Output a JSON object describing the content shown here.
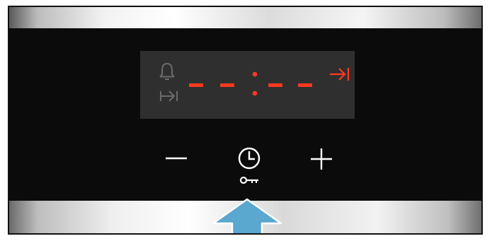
{
  "colors": {
    "panel": "#0b0b0b",
    "display": "#2f2f2f",
    "display_active": "#ff3a1f",
    "display_inactive": "#6b6b6b",
    "button_symbol": "#ffffff",
    "pointer_arrow": "#5aa7cf"
  },
  "display": {
    "alarm_icon": "bell-icon",
    "end_time_icon": "end-time-icon",
    "time_readout": "- - : - -",
    "active_function_icon": "end-time-icon"
  },
  "controls": [
    {
      "name": "minus-button",
      "symbol": "minus"
    },
    {
      "name": "clock-button",
      "symbol": "clock",
      "secondary_symbol": "key"
    },
    {
      "name": "plus-button",
      "symbol": "plus"
    }
  ],
  "pointer": {
    "icon": "up-arrow-icon",
    "points_to": "clock-button"
  }
}
